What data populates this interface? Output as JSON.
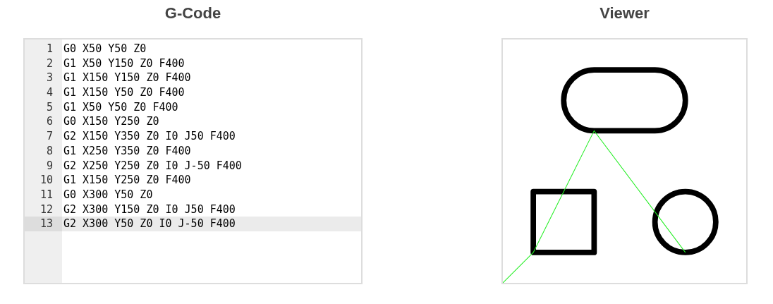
{
  "editor": {
    "title": "G-Code",
    "lines": [
      {
        "number": "1",
        "code": "G0 X50 Y50 Z0",
        "selected": false
      },
      {
        "number": "2",
        "code": "G1 X50 Y150 Z0 F400",
        "selected": false
      },
      {
        "number": "3",
        "code": "G1 X150 Y150 Z0 F400",
        "selected": false
      },
      {
        "number": "4",
        "code": "G1 X150 Y50 Z0 F400",
        "selected": false
      },
      {
        "number": "5",
        "code": "G1 X50 Y50 Z0 F400",
        "selected": false
      },
      {
        "number": "6",
        "code": "G0 X150 Y250 Z0",
        "selected": false
      },
      {
        "number": "7",
        "code": "G2 X150 Y350 Z0 I0 J50 F400",
        "selected": false
      },
      {
        "number": "8",
        "code": "G1 X250 Y350 Z0 F400",
        "selected": false
      },
      {
        "number": "9",
        "code": "G2 X250 Y250 Z0 I0 J-50 F400",
        "selected": false
      },
      {
        "number": "10",
        "code": "G1 X150 Y250 Z0 F400",
        "selected": false
      },
      {
        "number": "11",
        "code": "G0 X300 Y50 Z0",
        "selected": false
      },
      {
        "number": "12",
        "code": "G2 X300 Y150 Z0 I0 J50 F400",
        "selected": false
      },
      {
        "number": "13",
        "code": "G2 X300 Y50 Z0 I0 J-50 F400",
        "selected": true
      }
    ]
  },
  "viewer": {
    "title": "Viewer"
  }
}
